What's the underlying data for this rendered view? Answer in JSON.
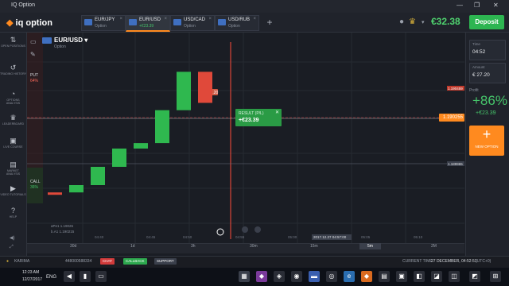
{
  "window": {
    "title": "IQ Option",
    "controls": [
      "—",
      "❐",
      "✕"
    ]
  },
  "header": {
    "logo": "iq option",
    "tabs": [
      {
        "name": "EUR/JPY",
        "sub": "Option",
        "active": false
      },
      {
        "name": "EUR/USD",
        "sub": "+€23.39",
        "active": true
      },
      {
        "name": "USD/CAD",
        "sub": "Option",
        "active": false
      },
      {
        "name": "USD/RUB",
        "sub": "Option",
        "active": false
      }
    ],
    "add_tab": "+",
    "balance": "€32.38",
    "deposit": "Deposit"
  },
  "sidebar": {
    "items": [
      {
        "label": "OPEN POSITIONS",
        "icon": "⇅"
      },
      {
        "label": "TRADING HISTORY",
        "icon": "↺"
      },
      {
        "label": "OPTIONS ANALYSIS",
        "icon": "◔"
      },
      {
        "label": "LEADERBOARD",
        "icon": "♛"
      },
      {
        "label": "LIVE COURSE",
        "icon": "▣"
      },
      {
        "label": "MARKET ANALYSIS",
        "icon": "▤"
      },
      {
        "label": "VIDEO TUTORIALS",
        "icon": "▶"
      },
      {
        "label": "HELP",
        "icon": "?"
      }
    ]
  },
  "chart_tools": [
    "▭",
    "✎"
  ],
  "asset": {
    "name": "EUR/USD ▾",
    "sub": "Option"
  },
  "sentiment": {
    "put_label": "PUT",
    "put_pct": "64%",
    "call_label": "CALL",
    "call_pct": "36%"
  },
  "result": {
    "title": "RESULT (P/L)",
    "value": "+€23.39",
    "close": "✕"
  },
  "current_price": "1.190255",
  "price_labels": [
    "1.190459",
    "1.189965"
  ],
  "expiry_label": "€27.20",
  "chart_corner_text": [
    "aPe1 1.19026",
    "b.A1 1.190215"
  ],
  "time_ticks": [
    "04:40",
    "04:45",
    "04:50",
    "04:55",
    "05:00",
    "05:05",
    "05:10"
  ],
  "time_cursor_label": "2017.12.27 04:57:00",
  "chart_data": {
    "type": "candlestick",
    "candles": [
      {
        "o": 0.5,
        "c": 0.6,
        "dir": "down"
      },
      {
        "o": 0.6,
        "c": 1.0,
        "dir": "up"
      },
      {
        "o": 1.0,
        "c": 2.0,
        "dir": "up"
      },
      {
        "o": 2.0,
        "c": 3.0,
        "dir": "up"
      },
      {
        "o": 3.0,
        "c": 3.3,
        "dir": "up"
      },
      {
        "o": 3.3,
        "c": 5.1,
        "dir": "up"
      },
      {
        "o": 5.1,
        "c": 7.2,
        "dir": "up"
      },
      {
        "o": 7.2,
        "c": 5.5,
        "dir": "down"
      }
    ]
  },
  "right_panel": {
    "time_label": "Time",
    "time_value": "04:52",
    "amount_label": "Amount",
    "amount_value": "€ 27.20",
    "profit_label": "Profit",
    "profit_pct": "+86%",
    "profit_amount": "+€23.39",
    "new_option": "NEW OPTION"
  },
  "timeframes": [
    "30d",
    "1d",
    "3h",
    "30m",
    "15m",
    "5m",
    "2M"
  ],
  "active_timeframe": "5m",
  "statusbar": {
    "user": "KARIMA",
    "phone": "448000588334",
    "chat": "CHAT",
    "callback": "CALLBACK",
    "support": "SUPPORT",
    "current_time_label": "CURRENT TIME:",
    "current_time": "27 DECEMBER, 04:52:51",
    "gmt": "(UTC+0)"
  },
  "taskbar": {
    "time": "12/27/2017",
    "lang": "ENG"
  }
}
